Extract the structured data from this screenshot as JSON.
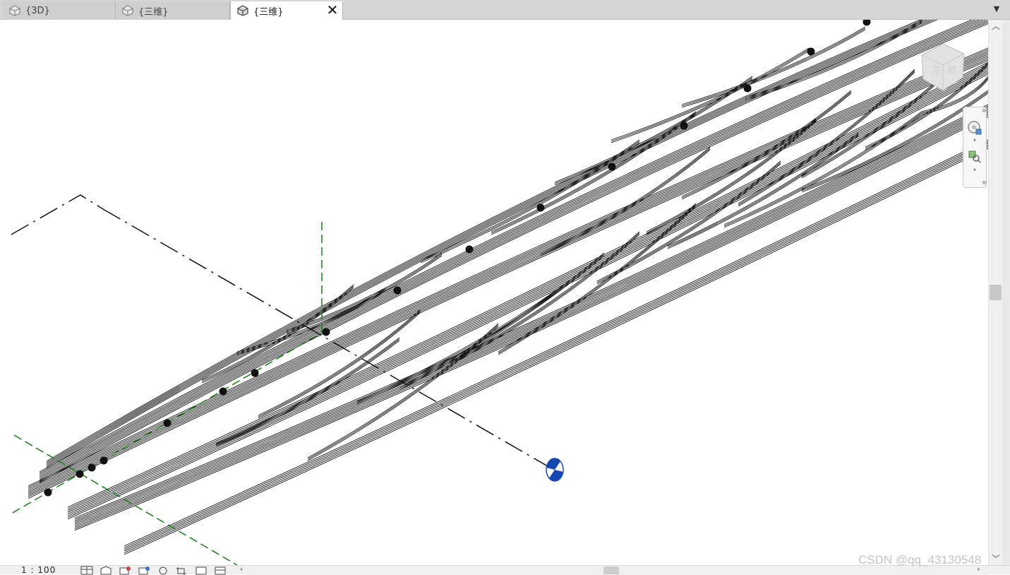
{
  "tabs": [
    {
      "label": "{3D}",
      "active": false,
      "icon": "house-3d-icon"
    },
    {
      "label": "{三维}",
      "active": false,
      "icon": "house-3d-icon"
    },
    {
      "label": "{三维}",
      "active": true,
      "icon": "house-3d-icon",
      "close": "✕"
    }
  ],
  "tab_menu_symbol": "▼",
  "status": {
    "scale": "1 : 100"
  },
  "view_controls": [
    "detail-level-icon",
    "visual-style-icon",
    "sun-path-icon",
    "shadows-icon",
    "render-icon",
    "crop-view-icon",
    "show-crop-icon",
    "temporary-hide-icon"
  ],
  "watermark": "CSDN @qq_43130548",
  "colors": {
    "tabbar_bg": "#d5d5d5",
    "active_tab": "#ffffff",
    "curve_stroke": "#111111",
    "grid_green": "#1a7a1a",
    "section_black": "#111111",
    "compass_blue": "#1646b0"
  }
}
